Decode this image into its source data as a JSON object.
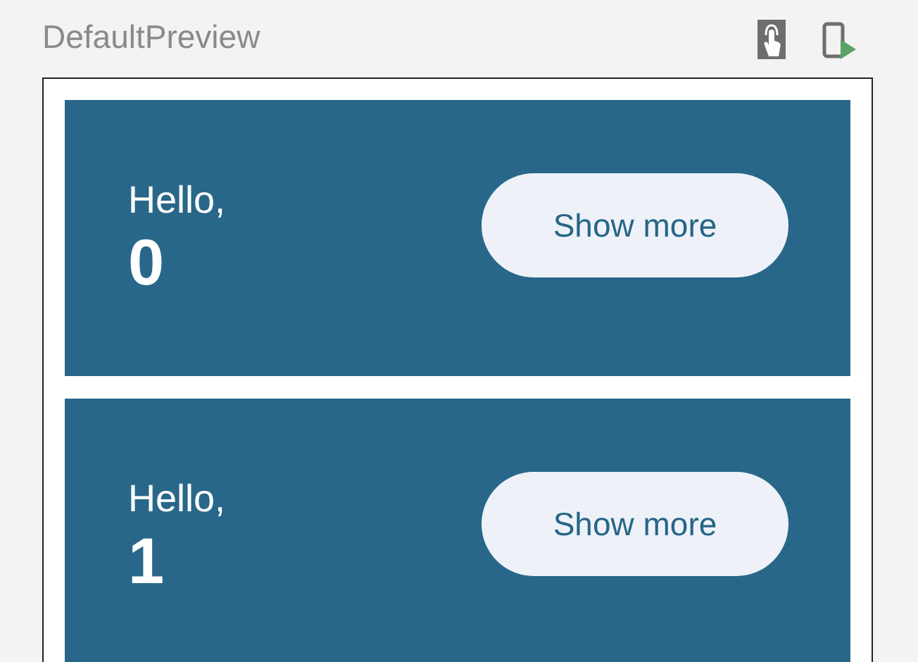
{
  "title": "DefaultPreview",
  "cards": [
    {
      "greeting": "Hello,",
      "count": "0",
      "button": "Show more"
    },
    {
      "greeting": "Hello,",
      "count": "1",
      "button": "Show more"
    }
  ]
}
